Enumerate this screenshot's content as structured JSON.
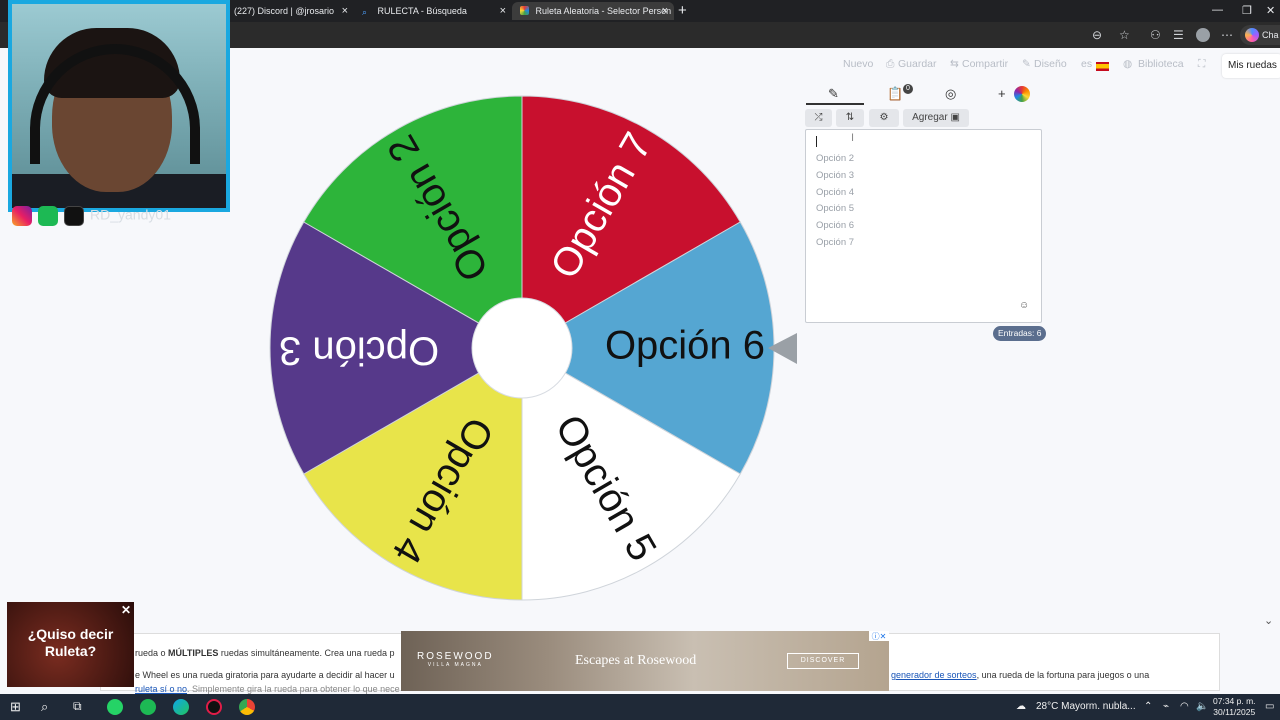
{
  "browser": {
    "tabs": [
      {
        "label": "(227) Discord | @jrosario",
        "active": false
      },
      {
        "label": "RULECTA - Búsqueda",
        "active": false
      },
      {
        "label": "Ruleta Aleatoria - Selector Person",
        "active": true
      }
    ],
    "new_tab_glyph": "+",
    "chat_label": "Cha"
  },
  "site_nav": {
    "nuevo": "Nuevo",
    "guardar": "Guardar",
    "compartir": "Compartir",
    "diseno": "Diseño",
    "lang": "es",
    "biblioteca": "Biblioteca",
    "mis_ruedas": "Mis ruedas"
  },
  "wheel": {
    "segments": [
      {
        "label": "Opción 7",
        "color": "#c8102e",
        "text_color": "#ffffff"
      },
      {
        "label": "Opción 6",
        "color": "#55a6d2",
        "text_color": "#111111"
      },
      {
        "label": "Opción 5",
        "color": "#ffffff",
        "text_color": "#111111"
      },
      {
        "label": "Opción 4",
        "color": "#e8e44a",
        "text_color": "#111111"
      },
      {
        "label": "Opción 3",
        "color": "#56398a",
        "text_color": "#ffffff"
      },
      {
        "label": "Opción 2",
        "color": "#2db43a",
        "text_color": "#111111"
      }
    ]
  },
  "editor": {
    "add_label": "Agregar",
    "notes_badge": "0",
    "entries": [
      "Opción 2",
      "Opción 3",
      "Opción 4",
      "Opción 5",
      "Opción 6",
      "Opción 7"
    ],
    "entries_count_label": "Entradas: 6"
  },
  "webcam": {
    "social_handle": "RD_yandy01"
  },
  "ad_left": {
    "text_line1": "¿Quiso decir",
    "text_line2": "Ruleta?"
  },
  "content_strip": {
    "line1_prefix": "rueda o",
    "line1_bold": "MÚLTIPLES",
    "line1_suffix": "ruedas simultáneamente. Crea una rueda p",
    "line2_prefix": "e Wheel es una rueda giratoria para ayudarte a decidir al hacer u",
    "line2_link": "generador de sorteos",
    "line2_suffix": ", una rueda de la fortuna para juegos o una",
    "line3_link": "ruleta sí o no",
    "line3_suffix": ". Simplemente gira la rueda para obtener lo que nece"
  },
  "ad_banner": {
    "brand": "ROSEWOOD",
    "brand_sub": "VILLA MAGNA",
    "tagline": "Escapes at Rosewood",
    "cta": "DISCOVER"
  },
  "taskbar": {
    "weather": "28°C  Mayorm. nubla...",
    "time": "07:34 p. m.",
    "date": "30/11/2025"
  }
}
